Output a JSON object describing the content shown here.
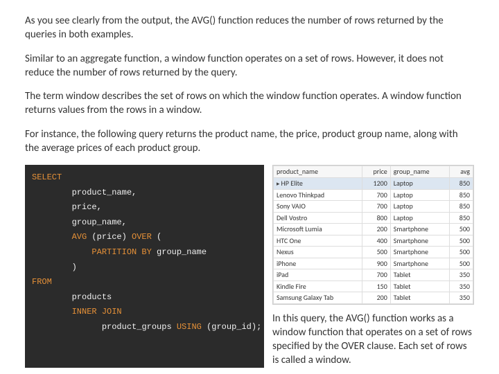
{
  "paragraphs": {
    "p1": "As you see clearly from the output, the AVG() function reduces the number of rows returned by the queries in both examples.",
    "p2": "Similar to an aggregate function, a window function operates on a set of rows. However, it does not reduce the number of rows returned by the query.",
    "p3": "The term window describes the set of rows on which the window function operates. A window function returns values from the rows in a window.",
    "p4": "For instance, the following query returns the product name, the price, product group name, along with the average prices of each product group."
  },
  "sql": {
    "kw_select": "SELECT",
    "col1": "product_name,",
    "col2": "price,",
    "col3": "group_name,",
    "kw_avg": "AVG",
    "avg_arg": " (price) ",
    "kw_over": "OVER",
    "over_open": " (",
    "kw_partition": "PARTITION BY",
    "partition_col": " group_name",
    "close_paren": ")",
    "kw_from": "FROM",
    "tbl1": "products",
    "kw_inner": "INNER JOIN",
    "tbl2": "product_groups ",
    "kw_using": "USING",
    "using_arg": " (group_id);"
  },
  "table": {
    "headers": {
      "c1": "product_name",
      "c2": "price",
      "c3": "group_name",
      "c4": "avg"
    },
    "rows": [
      {
        "name": "HP Elite",
        "price": "1200",
        "group": "Laptop",
        "avg": "850",
        "hl": true
      },
      {
        "name": "Lenovo Thinkpad",
        "price": "700",
        "group": "Laptop",
        "avg": "850"
      },
      {
        "name": "Sony VAIO",
        "price": "700",
        "group": "Laptop",
        "avg": "850"
      },
      {
        "name": "Dell Vostro",
        "price": "800",
        "group": "Laptop",
        "avg": "850"
      },
      {
        "name": "Microsoft Lumia",
        "price": "200",
        "group": "Smartphone",
        "avg": "500"
      },
      {
        "name": "HTC One",
        "price": "400",
        "group": "Smartphone",
        "avg": "500"
      },
      {
        "name": "Nexus",
        "price": "500",
        "group": "Smartphone",
        "avg": "500"
      },
      {
        "name": "iPhone",
        "price": "900",
        "group": "Smartphone",
        "avg": "500"
      },
      {
        "name": "iPad",
        "price": "700",
        "group": "Tablet",
        "avg": "350"
      },
      {
        "name": "Kindle Fire",
        "price": "150",
        "group": "Tablet",
        "avg": "350"
      },
      {
        "name": "Samsung Galaxy Tab",
        "price": "200",
        "group": "Tablet",
        "avg": "350"
      }
    ]
  },
  "explain": "In this query, the AVG() function works as a window function that operates on a set of rows specified by the OVER clause. Each set of rows is called a window."
}
